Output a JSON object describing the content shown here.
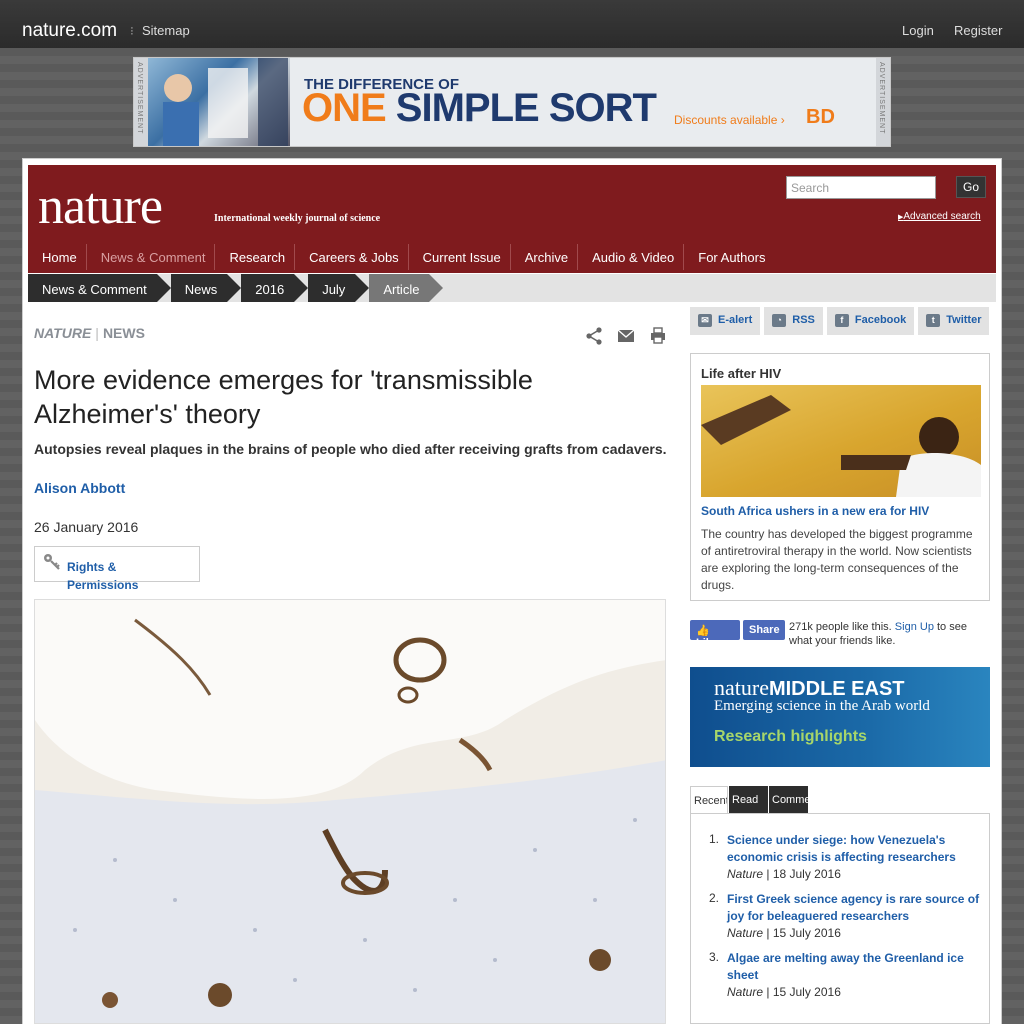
{
  "topbar": {
    "site_name": "nature.com",
    "separator": "⁝",
    "sitemap": "Sitemap",
    "login": "Login",
    "register": "Register"
  },
  "advertisement": {
    "side_label": "ADVERTISEMENT",
    "headline_small": "THE DIFFERENCE OF",
    "headline_one": "ONE",
    "headline_rest": " SIMPLE SORT",
    "cta": "Discounts available ›",
    "brand": "BD"
  },
  "masthead": {
    "logo": "nature",
    "tagline": "International weekly journal of science",
    "search_placeholder": "Search",
    "go_label": "Go",
    "advanced_search": "Advanced search"
  },
  "nav": {
    "items": [
      "Home",
      "News & Comment",
      "Research",
      "Careers & Jobs",
      "Current Issue",
      "Archive",
      "Audio & Video",
      "For Authors"
    ],
    "active": "News & Comment"
  },
  "breadcrumb": [
    "News & Comment",
    "News",
    "2016",
    "July",
    "Article"
  ],
  "article": {
    "journal": "NATURE",
    "section": "NEWS",
    "title": "More evidence emerges for 'transmissible Alzheimer's' theory",
    "standfirst": "Autopsies reveal plaques in the brains of people who died after receiving grafts from cadavers.",
    "author": "Alison Abbott",
    "date": "26 January 2016",
    "rights_label": "Rights & Permissions"
  },
  "share_buttons": [
    {
      "label": "E-alert",
      "icon": "email-icon"
    },
    {
      "label": "RSS",
      "icon": "rss-icon"
    },
    {
      "label": "Facebook",
      "icon": "facebook-icon"
    },
    {
      "label": "Twitter",
      "icon": "twitter-icon"
    }
  ],
  "promo": {
    "heading": "Life after HIV",
    "link": "South Africa ushers in a new era for HIV",
    "text": "The country has developed the biggest programme of antiretroviral therapy in the world. Now scientists are exploring the long-term consequences of the drugs."
  },
  "facebook": {
    "like": "Like",
    "share": "Share",
    "text_before": "271k people like this.",
    "signup": "Sign Up",
    "text_after": "to see what your friends like."
  },
  "middle_east": {
    "brand_nature": "nature",
    "brand_region": "MIDDLE EAST",
    "subtitle": "Emerging science in the Arab world",
    "highlight": "Research highlights"
  },
  "tabs": [
    "Recent",
    "Read",
    "Commented"
  ],
  "recent": [
    {
      "num": "1.",
      "title": "Science under siege: how Venezuela's economic crisis is affecting researchers",
      "journal": "Nature",
      "date": "| 18 July 2016"
    },
    {
      "num": "2.",
      "title": "First Greek science agency is rare source of joy for beleaguered researchers",
      "journal": "Nature",
      "date": "| 15 July 2016"
    },
    {
      "num": "3.",
      "title": "Algae are melting away the Greenland ice sheet",
      "journal": "Nature",
      "date": "| 15 July 2016"
    }
  ]
}
